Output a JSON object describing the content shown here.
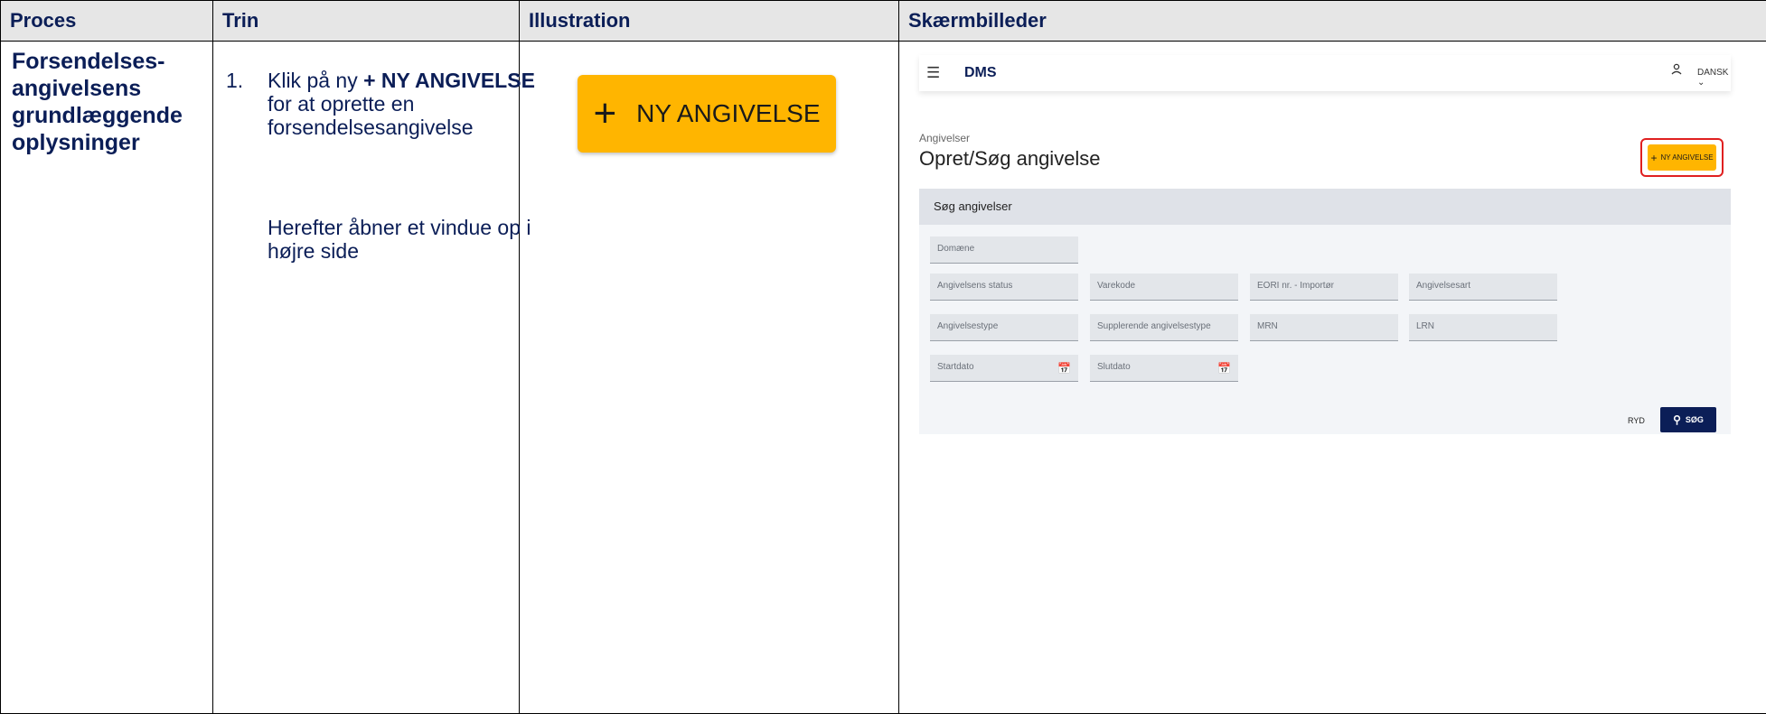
{
  "headers": [
    "Proces",
    "Trin",
    "Illustration",
    "Skærmbilleder"
  ],
  "proces": "Forsendelses-angivelsens grundlæggende oplysninger",
  "step": {
    "number": "1.",
    "pre": "Klik på ny ",
    "bold": "+ NY ANGIVELSE",
    "post": " for at oprette en forsendelsesangivelse",
    "note": "Herefter åbner et vindue op i højre side"
  },
  "illustration": {
    "button_label": "NY ANGIVELSE",
    "icon": "plus-icon"
  },
  "screen": {
    "app_title": "DMS",
    "language": "DANSK",
    "breadcrumb": "Angivelser",
    "title": "Opret/Søg angivelse",
    "new_button": "NY ANGIVELSE",
    "search_panel_title": "Søg angivelser",
    "fields": {
      "domaene": "Domæne",
      "status": "Angivelsens status",
      "varekode": "Varekode",
      "eori": "EORI nr. - Importør",
      "angivelsesart": "Angivelsesart",
      "angivelsestype": "Angivelsestype",
      "supplerende": "Supplerende angivelsestype",
      "mrn": "MRN",
      "lrn": "LRN",
      "startdato": "Startdato",
      "slutdato": "Slutdato"
    },
    "clear_button": "RYD",
    "search_button": "SØG",
    "colors": {
      "accent": "#ffb500",
      "navy": "#0b1e57",
      "highlight": "#e02020"
    }
  }
}
